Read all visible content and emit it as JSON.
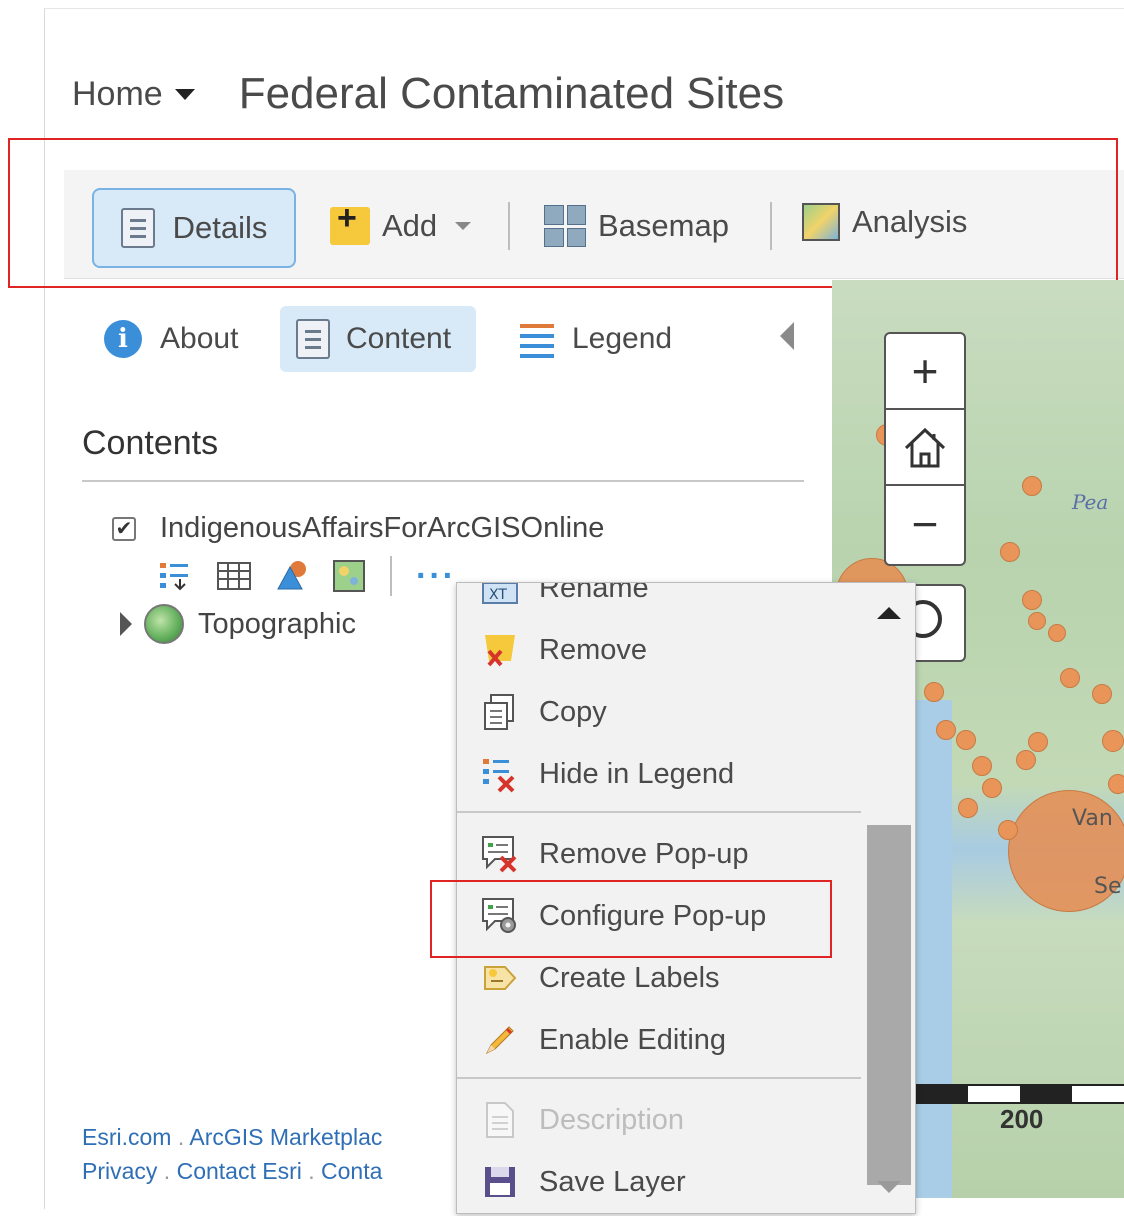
{
  "header": {
    "home_label": "Home",
    "title": "Federal Contaminated Sites"
  },
  "toolbar": {
    "details": "Details",
    "add": "Add",
    "basemap": "Basemap",
    "analysis": "Analysis"
  },
  "tabs": {
    "about": "About",
    "content": "Content",
    "legend": "Legend"
  },
  "contents": {
    "heading": "Contents",
    "layers": [
      {
        "name": "IndigenousAffairsForArcGISOnline",
        "checked": true
      },
      {
        "name": "Topographic"
      }
    ]
  },
  "context_menu": {
    "items": [
      {
        "label": "Rename",
        "icon": "rename-icon"
      },
      {
        "label": "Remove",
        "icon": "remove-icon"
      },
      {
        "label": "Copy",
        "icon": "copy-icon"
      },
      {
        "label": "Hide in Legend",
        "icon": "hide-legend-icon"
      },
      {
        "label": "Remove Pop-up",
        "icon": "remove-popup-icon"
      },
      {
        "label": "Configure Pop-up",
        "icon": "configure-popup-icon"
      },
      {
        "label": "Create Labels",
        "icon": "create-labels-icon"
      },
      {
        "label": "Enable Editing",
        "icon": "pencil-icon"
      },
      {
        "label": "Description",
        "icon": "description-icon",
        "disabled": true
      },
      {
        "label": "Save Layer",
        "icon": "save-icon"
      }
    ]
  },
  "map": {
    "zoom_in": "+",
    "zoom_out": "−",
    "scale_label": "200",
    "labels": [
      "Pea",
      "Van",
      "Se"
    ]
  },
  "footer": {
    "line1": [
      "Esri.com",
      "ArcGIS Marketplac"
    ],
    "line2": [
      "Privacy",
      "Contact Esri",
      "Conta"
    ]
  },
  "colors": {
    "highlight": "#e02424",
    "accent": "#3b8fd9",
    "site_marker": "#e9955a"
  }
}
